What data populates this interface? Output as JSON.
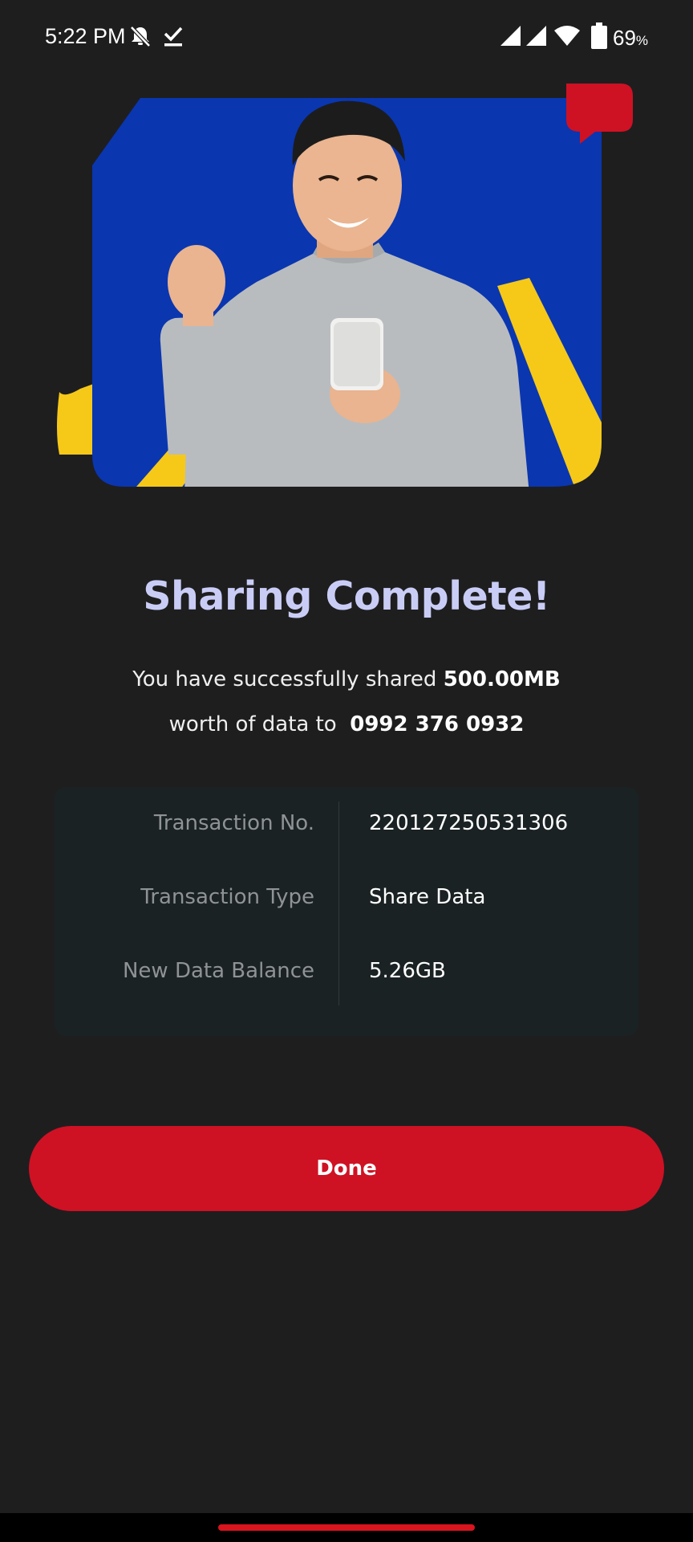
{
  "status_bar": {
    "time": "5:22 PM",
    "battery_level": "69",
    "battery_unit": "%",
    "icons": [
      "dnd-bell-off-icon",
      "checkmark-download-icon",
      "signal-icon",
      "signal-icon",
      "wifi-icon",
      "battery-icon"
    ]
  },
  "hero": {
    "image": "man-celebrating-with-phone-illustration",
    "colors": {
      "background_panel": "#0a36b0",
      "accent_yellow": "#f6c919",
      "accent_red": "#cf1124"
    }
  },
  "result": {
    "title": "Sharing Complete!",
    "message_part1": "You have successfully shared ",
    "amount": "500.00MB",
    "message_part2": "worth of data to ",
    "recipient": "0992 376 0932"
  },
  "details": [
    {
      "label": "Transaction No.",
      "value": "220127250531306"
    },
    {
      "label": "Transaction Type",
      "value": "Share Data"
    },
    {
      "label": "New Data Balance",
      "value": "5.26GB"
    }
  ],
  "actions": {
    "done_label": "Done",
    "done_color": "#cf1124"
  },
  "theme": {
    "background": "#1e1e1f",
    "title_color": "#c9cdf6",
    "card_background": "#1b2224"
  }
}
